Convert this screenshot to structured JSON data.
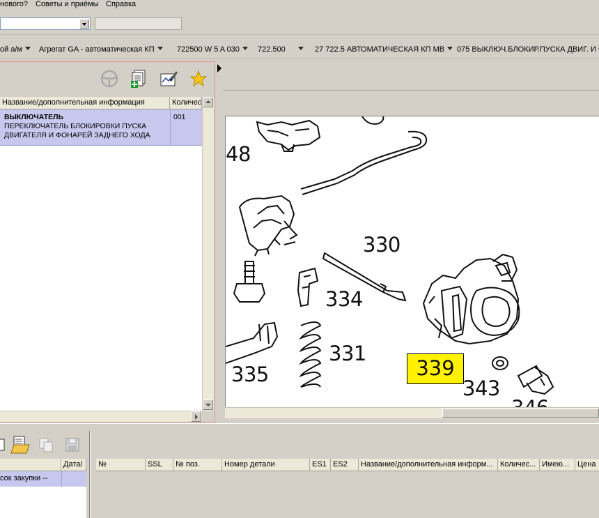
{
  "menubar": {
    "items": [
      "нового?",
      "Советы и приёмы",
      "Справка"
    ]
  },
  "breadcrumbs": [
    "ой а/м",
    "Агрегат GA - автоматическая КП",
    "722500 W 5 A 030",
    "722.500",
    "27 722.5 АВТОМАТИЧЕСКАЯ КП MB",
    "075 ВЫКЛЮЧ.БЛОКИР.ПУСКА ДВИГ. И Ф"
  ],
  "parts_list": {
    "headers": [
      "Название/дополнительная информация",
      "Количес"
    ],
    "rows": [
      {
        "name": "ВЫКЛЮЧАТЕЛЬ",
        "info": "ПЕРЕКЛЮЧАТЕЛЬ БЛОКИРОВКИ ПУСКА ДВИГАТЕЛЯ И ФОНАРЕЙ ЗАДНЕГО ХОДА",
        "qty": "001"
      }
    ]
  },
  "drawing": {
    "labels": [
      "48",
      "330",
      "334",
      "331",
      "335",
      "343",
      "346"
    ],
    "highlighted_label": "339",
    "highlight_color": "#fff200"
  },
  "purchase_list": {
    "headers": [
      "Дата/"
    ],
    "rows": [
      {
        "name": "сок закупки --"
      }
    ]
  },
  "order_table": {
    "headers": [
      "№",
      "SSL",
      "№ поз.",
      "Номер детали",
      "ES1",
      "ES2",
      "Название/дополнительная информ...",
      "Количес...",
      "Имею...",
      "Цена"
    ]
  },
  "colors": {
    "selection": "#c8c7ee",
    "panel_border": "#e2928a",
    "face": "#d4d0c8"
  }
}
